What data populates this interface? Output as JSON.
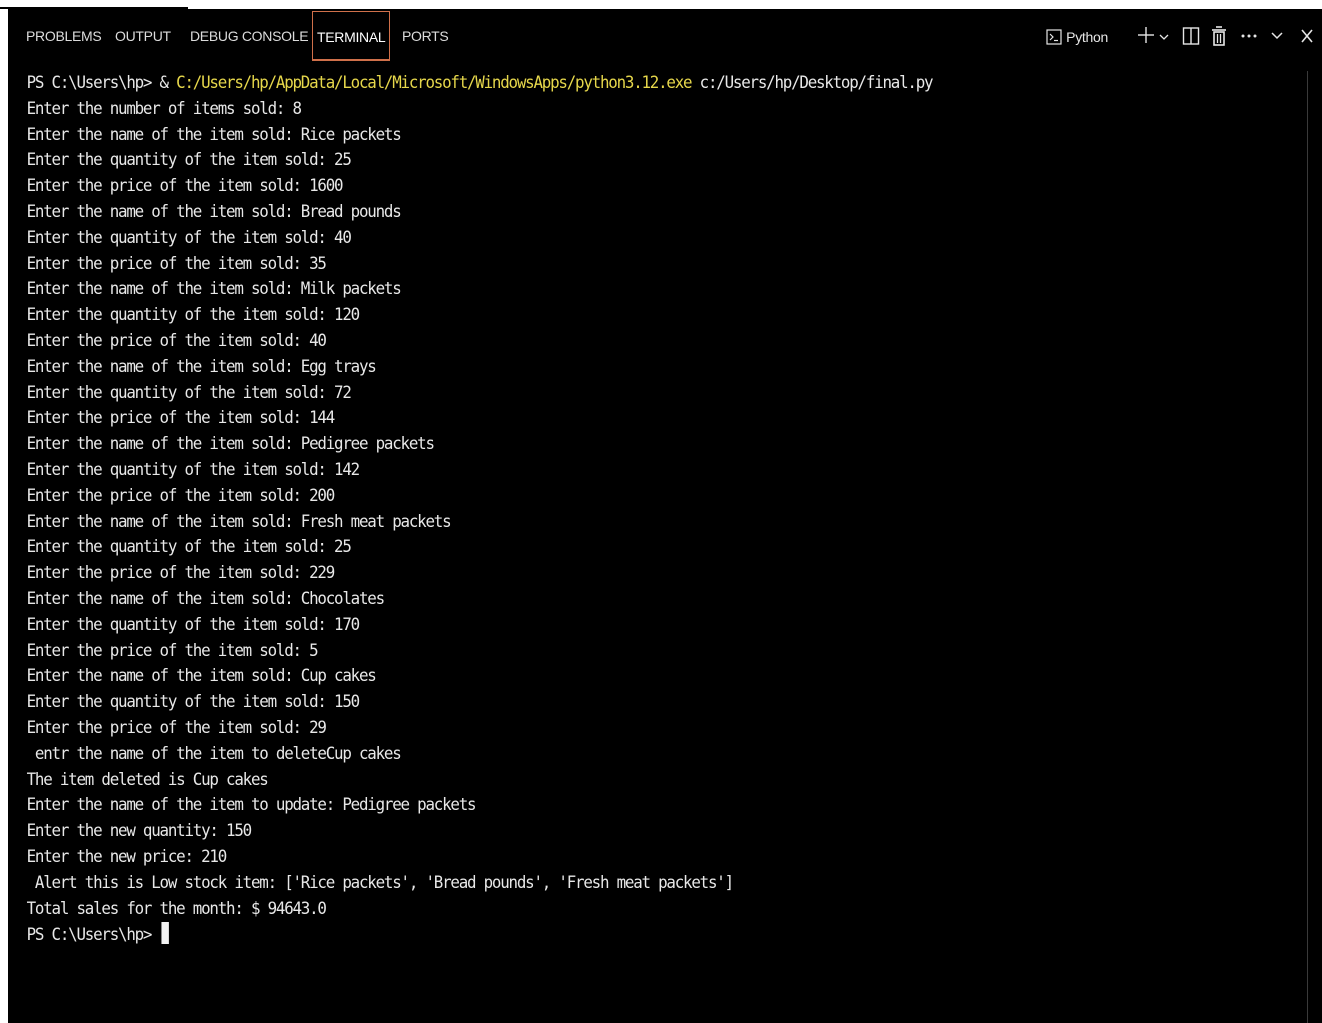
{
  "tabs": [
    {
      "label": "PROBLEMS"
    },
    {
      "label": "OUTPUT"
    },
    {
      "label": "DEBUG CONSOLE"
    },
    {
      "label": "TERMINAL"
    },
    {
      "label": "PORTS"
    }
  ],
  "active_tab": "TERMINAL",
  "toolbar": {
    "shell_icon": "terminal-icon",
    "shell_label": "Python",
    "new_terminal_icon": "plus-icon",
    "dropdown_icon": "chevron-down-icon",
    "split_icon": "split-terminal-icon",
    "kill_icon": "trash-icon",
    "more_icon": "ellipsis-icon",
    "collapse_icon": "chevron-down-icon",
    "close_icon": "close-icon"
  },
  "terminal": {
    "command": {
      "prompt": "PS C:\\Users\\hp> & ",
      "executable": "C:/Users/hp/AppData/Local/Microsoft/WindowsApps/python3.12.exe",
      "argument": " c:/Users/hp/Desktop/final.py"
    },
    "lines": [
      "Enter the number of items sold: 8",
      "Enter the name of the item sold: Rice packets",
      "Enter the quantity of the item sold: 25",
      "Enter the price of the item sold: 1600",
      "Enter the name of the item sold: Bread pounds",
      "Enter the quantity of the item sold: 40",
      "Enter the price of the item sold: 35",
      "Enter the name of the item sold: Milk packets",
      "Enter the quantity of the item sold: 120",
      "Enter the price of the item sold: 40",
      "Enter the name of the item sold: Egg trays",
      "Enter the quantity of the item sold: 72",
      "Enter the price of the item sold: 144",
      "Enter the name of the item sold: Pedigree packets",
      "Enter the quantity of the item sold: 142",
      "Enter the price of the item sold: 200",
      "Enter the name of the item sold: Fresh meat packets",
      "Enter the quantity of the item sold: 25",
      "Enter the price of the item sold: 229",
      "Enter the name of the item sold: Chocolates",
      "Enter the quantity of the item sold: 170",
      "Enter the price of the item sold: 5",
      "Enter the name of the item sold: Cup cakes",
      "Enter the quantity of the item sold: 150",
      "Enter the price of the item sold: 29",
      " entr the name of the item to deleteCup cakes",
      "The item deleted is Cup cakes",
      "Enter the name of the item to update: Pedigree packets",
      "Enter the new quantity: 150",
      "Enter the new price: 210",
      " Alert this is Low stock item: ['Rice packets', 'Bread pounds', 'Fresh meat packets']",
      "Total sales for the month: $ 94643.0"
    ],
    "final_prompt": "PS C:\\Users\\hp> "
  },
  "colors": {
    "background": "#000000",
    "text": "#e8e8e8",
    "path_highlight": "#e6d74b",
    "active_tab_border": "#d0704a"
  }
}
